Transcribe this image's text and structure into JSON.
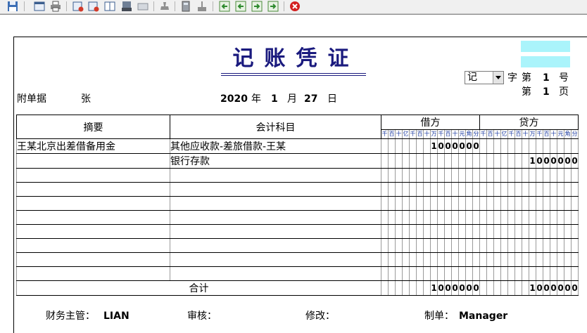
{
  "toolbar": {
    "buttons": [
      "save-icon",
      "preview-icon",
      "print-icon",
      "add-entry-icon",
      "add-row-icon",
      "book-icon",
      "scanner-icon",
      "keyboard-icon",
      "stamp-icon",
      "calculator-icon",
      "tool-icon",
      "first-icon",
      "prev-icon",
      "next-icon",
      "last-icon",
      "close-icon"
    ]
  },
  "voucher": {
    "title": "记账凭证",
    "attachments_label": "附单据",
    "attachments_value": "张",
    "date": {
      "year": "2020",
      "year_label": "年",
      "month": "1",
      "month_label": "月",
      "day": "27",
      "day_label": "日"
    },
    "word_select": "记",
    "word_label": "字",
    "number_prefix": "第",
    "number_value": "1",
    "number_suffix": "号",
    "page_prefix": "第",
    "page_value": "1",
    "page_suffix": "页"
  },
  "table": {
    "col_summary": "摘要",
    "col_subject": "会计科目",
    "col_debit": "借方",
    "col_credit": "贷方",
    "digit_labels": [
      "千",
      "百",
      "十",
      "亿",
      "千",
      "百",
      "十",
      "万",
      "千",
      "百",
      "十",
      "元",
      "角",
      "分"
    ],
    "rows": [
      {
        "summary": "王某北京出差借备用金",
        "subject": "其他应收款-差旅借款-王某",
        "debit": "1000000",
        "credit": ""
      },
      {
        "summary": "",
        "subject": "银行存款",
        "debit": "",
        "credit": "1000000"
      },
      {
        "summary": "",
        "subject": "",
        "debit": "",
        "credit": ""
      },
      {
        "summary": "",
        "subject": "",
        "debit": "",
        "credit": ""
      },
      {
        "summary": "",
        "subject": "",
        "debit": "",
        "credit": ""
      },
      {
        "summary": "",
        "subject": "",
        "debit": "",
        "credit": ""
      },
      {
        "summary": "",
        "subject": "",
        "debit": "",
        "credit": ""
      },
      {
        "summary": "",
        "subject": "",
        "debit": "",
        "credit": ""
      },
      {
        "summary": "",
        "subject": "",
        "debit": "",
        "credit": ""
      },
      {
        "summary": "",
        "subject": "",
        "debit": "",
        "credit": ""
      }
    ],
    "total_label": "合计",
    "total_debit": "1000000",
    "total_credit": "1000000"
  },
  "footer": {
    "supervisor_label": "财务主管：",
    "supervisor_value": "LIAN",
    "review_label": "审核：",
    "modify_label": "修改：",
    "maker_label": "制单：",
    "maker_value": "Manager"
  },
  "colors": {
    "title": "#1a1a7e",
    "digit_label": "#1c3ba2",
    "highlight": "#aaf4fb",
    "close": "#d32020"
  }
}
